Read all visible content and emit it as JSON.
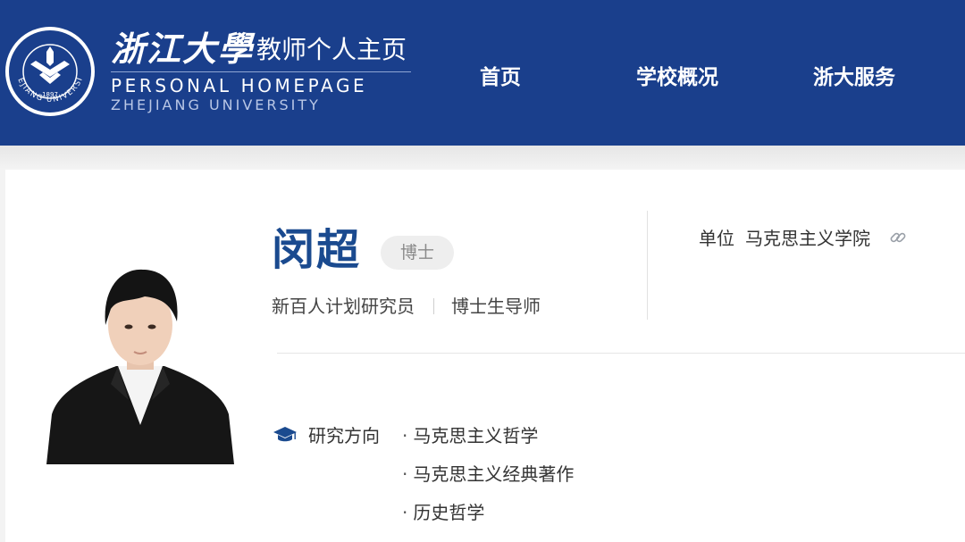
{
  "header": {
    "logo_cn": "浙江大學",
    "logo_subtitle": "教师个人主页",
    "logo_en_line1": "PERSONAL HOMEPAGE",
    "logo_en_line2": "ZHEJIANG UNIVERSITY",
    "nav": [
      "首页",
      "学校概况",
      "浙大服务"
    ],
    "colors": {
      "brand": "#1a3f8c",
      "name_blue": "#1a4a8f"
    }
  },
  "profile": {
    "name": "闵超",
    "degree": "博士",
    "titles": [
      "新百人计划研究员",
      "博士生导师"
    ],
    "unit_label": "单位",
    "unit_value": "马克思主义学院",
    "unit_icon": "link-icon"
  },
  "research": {
    "icon": "graduation-cap-icon",
    "label": "研究方向",
    "items": [
      "马克思主义哲学",
      "马克思主义经典著作",
      "历史哲学"
    ]
  }
}
